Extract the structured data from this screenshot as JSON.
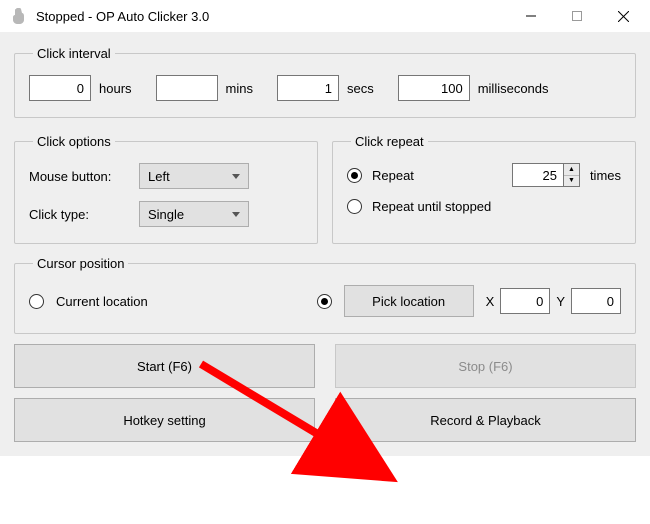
{
  "window": {
    "title": "Stopped - OP Auto Clicker 3.0"
  },
  "interval": {
    "legend": "Click interval",
    "hours": "0",
    "hours_label": "hours",
    "mins": "",
    "mins_label": "mins",
    "secs": "1",
    "secs_label": "secs",
    "ms": "100",
    "ms_label": "milliseconds"
  },
  "options": {
    "legend": "Click options",
    "mouse_label": "Mouse button:",
    "mouse_value": "Left",
    "type_label": "Click type:",
    "type_value": "Single"
  },
  "repeat": {
    "legend": "Click repeat",
    "repeat_label": "Repeat",
    "repeat_count": "25",
    "times_label": "times",
    "until_label": "Repeat until stopped"
  },
  "cursor": {
    "legend": "Cursor position",
    "current_label": "Current location",
    "pick_label": "Pick location",
    "x_label": "X",
    "x_value": "0",
    "y_label": "Y",
    "y_value": "0"
  },
  "buttons": {
    "start": "Start (F6)",
    "stop": "Stop (F6)",
    "hotkey": "Hotkey setting",
    "record": "Record & Playback"
  }
}
